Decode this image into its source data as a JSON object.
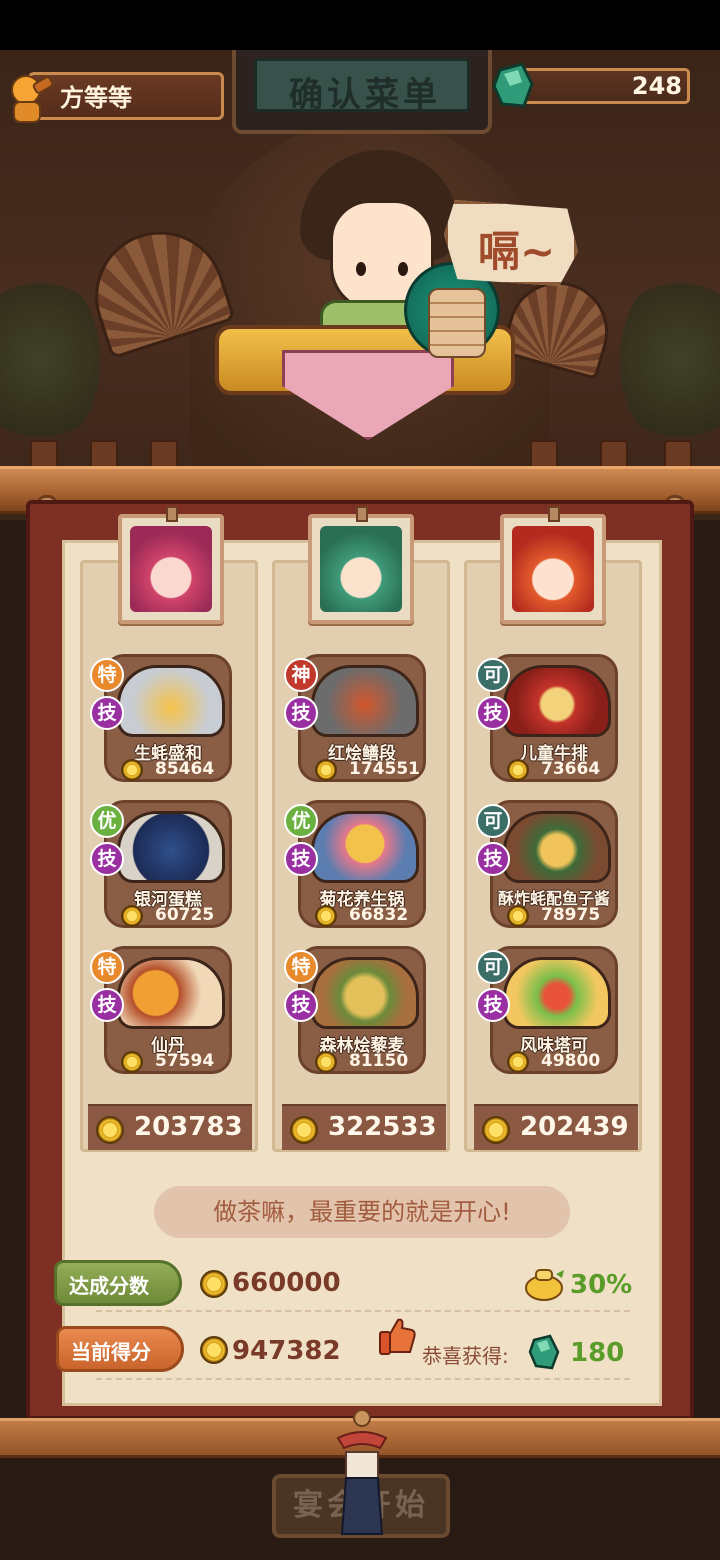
{
  "header": {
    "player_name": "方等等",
    "title": "确认菜单",
    "gems": "248"
  },
  "speech": "嗝~",
  "columns": [
    {
      "dishes": [
        {
          "badge": "特",
          "skill": "技",
          "name": "生蚝盛和",
          "price": "85464"
        },
        {
          "badge": "优",
          "skill": "技",
          "name": "银河蛋糕",
          "price": "60725"
        },
        {
          "badge": "特",
          "skill": "技",
          "name": "仙丹",
          "price": "57594"
        }
      ],
      "total": "203783"
    },
    {
      "dishes": [
        {
          "badge": "神",
          "skill": "技",
          "name": "红烩鳝段",
          "price": "174551"
        },
        {
          "badge": "优",
          "skill": "技",
          "name": "菊花养生锅",
          "price": "66832"
        },
        {
          "badge": "特",
          "skill": "技",
          "name": "森林烩藜麦",
          "price": "81150"
        }
      ],
      "total": "322533"
    },
    {
      "dishes": [
        {
          "badge": "可",
          "skill": "技",
          "name": "儿童牛排",
          "price": "73664"
        },
        {
          "badge": "可",
          "skill": "技",
          "name": "酥炸蚝配鱼子酱",
          "price": "78975"
        },
        {
          "badge": "可",
          "skill": "技",
          "name": "风味塔可",
          "price": "49800"
        }
      ],
      "total": "202439"
    }
  ],
  "motto": "做茶嘛，最重要的就是开心!",
  "target": {
    "label": "达成分数",
    "value": "660000",
    "bonus": "30%"
  },
  "current": {
    "label": "当前得分",
    "value": "947382",
    "reward_label": "恭喜获得:",
    "reward": "180"
  },
  "start_button": "宴会开始",
  "colors": {
    "accent": "#7d2f23",
    "paper": "#efe0c6",
    "gold": "#f1c232",
    "green": "#5a9c2a"
  }
}
